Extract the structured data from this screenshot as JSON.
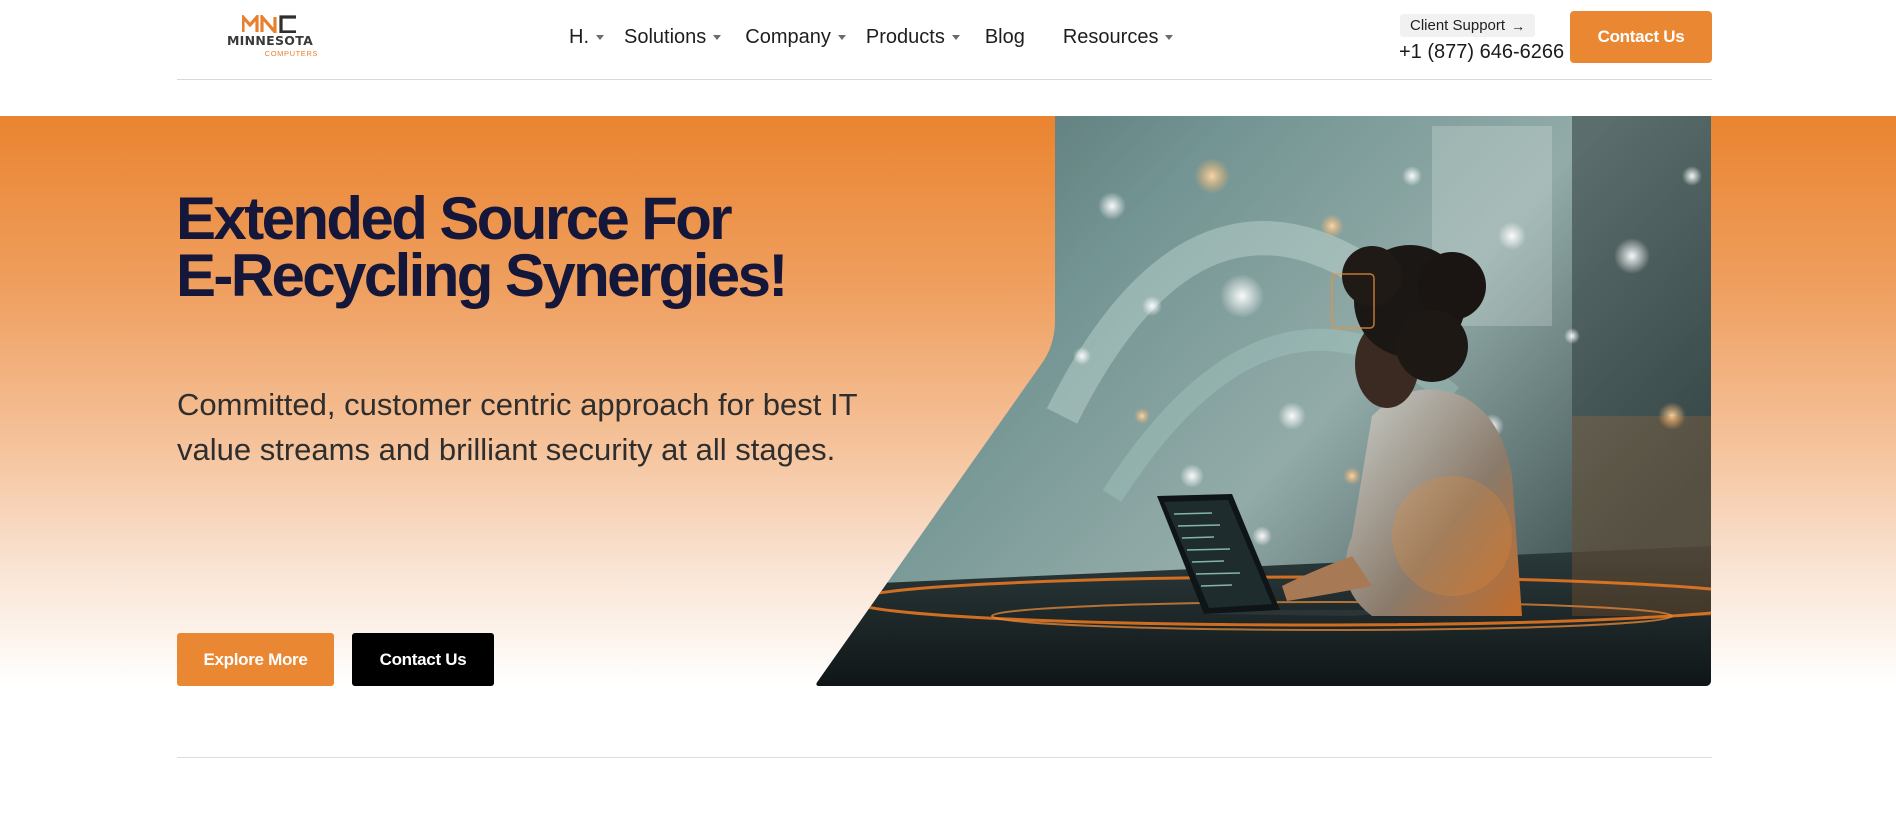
{
  "brand": {
    "name": "MINNESOTA",
    "sub": "COMPUTERS",
    "mark": "MNC",
    "accent_color": "#ea8733",
    "title_color": "#14163a"
  },
  "nav": {
    "items": [
      {
        "label": "H.",
        "has_dropdown": true
      },
      {
        "label": "Solutions",
        "has_dropdown": true
      },
      {
        "label": "Company",
        "has_dropdown": true
      },
      {
        "label": "Products",
        "has_dropdown": true
      },
      {
        "label": "Blog",
        "has_dropdown": false
      },
      {
        "label": "Resources",
        "has_dropdown": true
      }
    ]
  },
  "header": {
    "support_label": "Client Support",
    "support_icon": "arrow-right-icon",
    "phone": "+1 (877) 646-6266",
    "contact_label": "Contact Us"
  },
  "hero": {
    "title_line1": "Extended Source For",
    "title_line2": "E-Recycling Synergies!",
    "subtitle": "Committed, customer centric approach for best IT value streams and brilliant security at all stages.",
    "primary_label": "Explore More",
    "secondary_label": "Contact Us",
    "image_icon": "woman-laptop-technology-photo"
  }
}
